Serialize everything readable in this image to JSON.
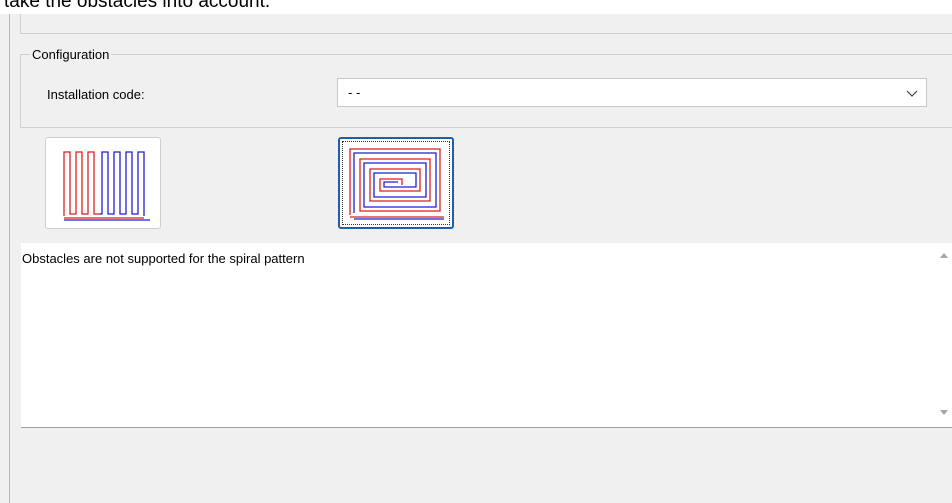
{
  "header": {
    "truncated_text": "take the obstacles into account."
  },
  "configuration": {
    "legend": "Configuration",
    "installation_code_label": "Installation code:",
    "installation_code_value": "- -"
  },
  "patterns": {
    "meander": {
      "icon": "meander-pattern-icon",
      "selected": false
    },
    "spiral": {
      "icon": "spiral-pattern-icon",
      "selected": true
    }
  },
  "message": {
    "text": "Obstacles are not supported for the spiral pattern"
  },
  "colors": {
    "pipe_red": "#e01f1f",
    "pipe_blue": "#1f1fd6",
    "selection_border": "#1f5fa8"
  }
}
